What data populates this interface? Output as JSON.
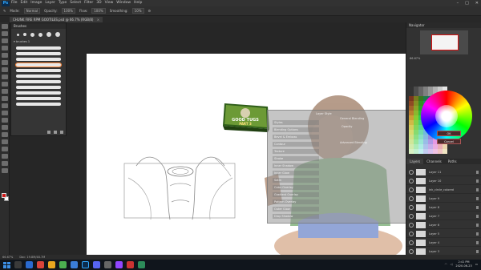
{
  "app": {
    "menu_logo": "Ps",
    "menu": [
      "File",
      "Edit",
      "Image",
      "Layer",
      "Type",
      "Select",
      "Filter",
      "3D",
      "View",
      "Window",
      "Help"
    ],
    "window_controls": [
      "–",
      "□",
      "✕"
    ]
  },
  "options_bar": {
    "mode_label": "Mode:",
    "mode_value": "Normal",
    "opacity_label": "Opacity:",
    "opacity_value": "100%",
    "flow_label": "Flow:",
    "flow_value": "100%",
    "smoothing_label": "Smoothing:",
    "smoothing_value": "10%"
  },
  "document_tab": {
    "title": "CHUNK FIRE RPM GOOTILES.psd @ 66.7% (RGB/8)",
    "close": "×"
  },
  "brushes_panel": {
    "title": "Brushes",
    "group_label": "▾ brushes 1"
  },
  "dialog_texts": {
    "title": "Layer Style",
    "blending_header": "General Blending",
    "advanced_header": "Advanced Blending",
    "opacity_label": "Opacity",
    "options": [
      "Styles",
      "Blending Options",
      "Bevel & Emboss",
      "Contour",
      "Texture",
      "Stroke",
      "Inner Shadow",
      "Inner Glow",
      "Satin",
      "Color Overlay",
      "Gradient Overlay",
      "Pattern Overlay",
      "Outer Glow",
      "Drop Shadow"
    ]
  },
  "box_art": {
    "line1": "GOOD TUGS",
    "line2": "PART 3"
  },
  "navigator": {
    "title": "Navigator",
    "zoom": "66.67%"
  },
  "color_picker": {
    "ok_label": "OK",
    "cancel_label": "Cancel"
  },
  "layers_panel": {
    "tabs": [
      "Layers",
      "Channels",
      "Paths"
    ],
    "layers": [
      "Layer 11",
      "Layer 10",
      "ink_circle_colored",
      "Layer 9",
      "Layer 8",
      "Layer 7",
      "Layer 6",
      "Layer 5",
      "Layer 4",
      "Layer 3"
    ]
  },
  "status_bar": {
    "zoom": "66.67%",
    "doc": "Doc: 19.8M/48.7M"
  },
  "taskbar": {
    "time": "2:41 PM",
    "date": "2020-06-23"
  },
  "colors": {
    "accent": "#31a8ff",
    "foreground_swatch": "#d01a1a",
    "background_swatch": "#ffffff",
    "box_green": "#5c8a2e"
  }
}
